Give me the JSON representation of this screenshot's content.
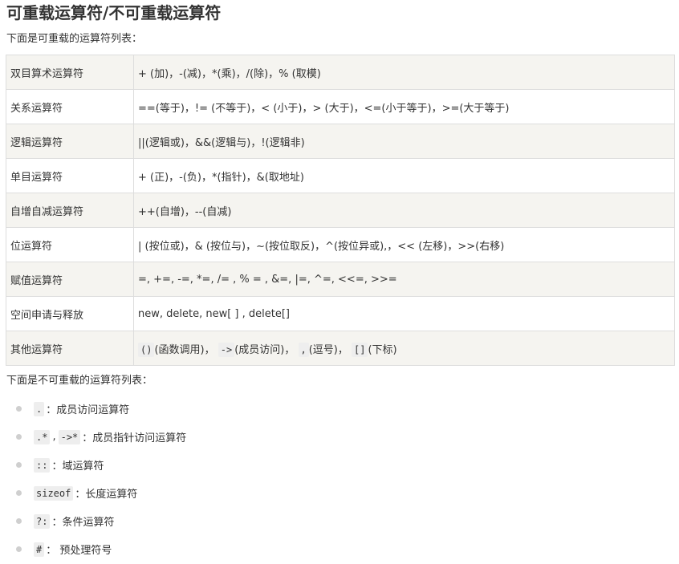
{
  "title": "可重载运算符/不可重载运算符",
  "overloadable": {
    "intro": "下面是可重载的运算符列表：",
    "rows": [
      {
        "category": "双目算术运算符",
        "desc": "+ (加)，-(减)，*(乘)，/(除)，% (取模)"
      },
      {
        "category": "关系运算符",
        "desc": "==(等于)，!= (不等于)，< (小于)，> (大于)，<=(小于等于)，>=(大于等于)"
      },
      {
        "category": "逻辑运算符",
        "desc": "||(逻辑或)，&&(逻辑与)，!(逻辑非)"
      },
      {
        "category": "单目运算符",
        "desc": "+ (正)，-(负)，*(指针)，&(取地址)"
      },
      {
        "category": "自增自减运算符",
        "desc": "++(自增)，--(自减)"
      },
      {
        "category": "位运算符",
        "desc": "| (按位或)，& (按位与)，~(按位取反)，^(按位异或),，<< (左移)，>>(右移)"
      },
      {
        "category": "赋值运算符",
        "desc": "=, +=, -=, *=, /= , % = , &=, |=, ^=, <<=, >>="
      },
      {
        "category": "空间申请与释放",
        "desc": "new, delete, new[ ] , delete[]"
      }
    ],
    "other": {
      "category": "其他运算符",
      "parts": [
        {
          "code": "()",
          "text": "(函数调用)，"
        },
        {
          "code": "->",
          "text": "(成员访问)，"
        },
        {
          "code": ",",
          "text": "(逗号)，"
        },
        {
          "code": "[]",
          "text": "(下标)"
        }
      ]
    }
  },
  "non_overloadable": {
    "intro": "下面是不可重载的运算符列表：",
    "items": [
      {
        "codes": [
          "."
        ],
        "text": "：成员访问运算符"
      },
      {
        "codes": [
          ".*",
          "->*"
        ],
        "sep": ",",
        "text": "：成员指针访问运算符"
      },
      {
        "codes": [
          "::"
        ],
        "text": "：域运算符"
      },
      {
        "codes": [
          "sizeof"
        ],
        "text": "：长度运算符"
      },
      {
        "codes": [
          "?:"
        ],
        "text": "：条件运算符"
      },
      {
        "codes": [
          "#"
        ],
        "text": "： 预处理符号"
      }
    ]
  }
}
